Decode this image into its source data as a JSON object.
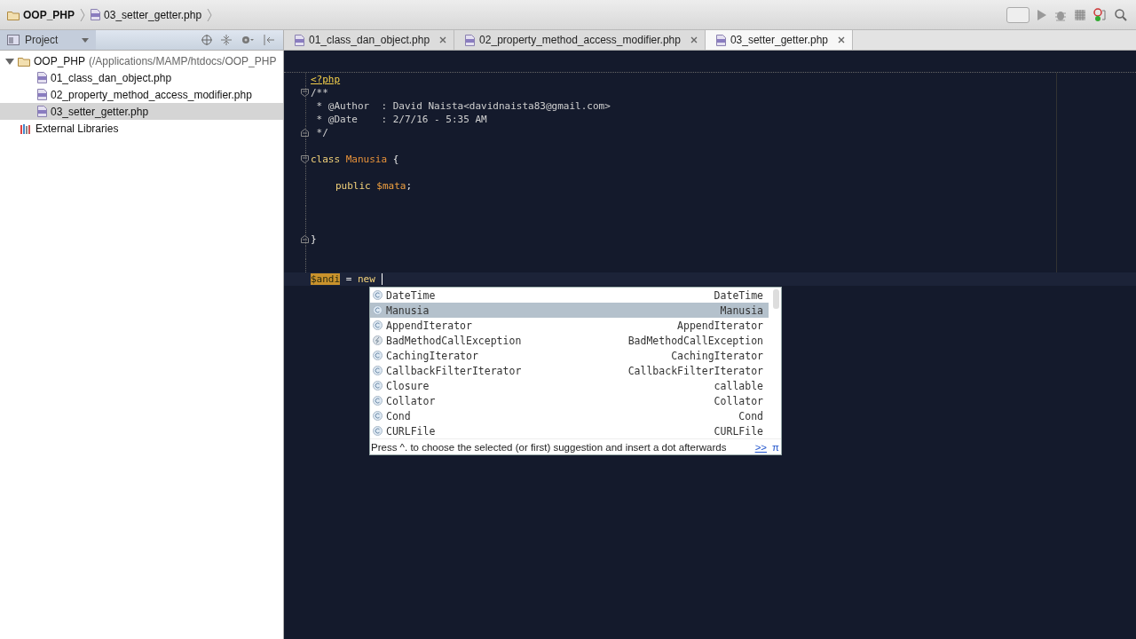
{
  "breadcrumb": [
    {
      "kind": "folder",
      "label": "OOP_PHP"
    },
    {
      "kind": "php",
      "label": "03_setter_getter.php"
    }
  ],
  "project_panel": {
    "title": "Project"
  },
  "tabs": [
    {
      "label": "01_class_dan_object.php",
      "selected": false
    },
    {
      "label": "02_property_method_access_modifier.php",
      "selected": false
    },
    {
      "label": "03_setter_getter.php",
      "selected": true
    }
  ],
  "tree": [
    {
      "kind": "folder",
      "label": "OOP_PHP",
      "path": " (/Applications/MAMP/htdocs/OOP_PHP",
      "expanded": true,
      "selected": false,
      "children": [
        {
          "kind": "php",
          "label": "01_class_dan_object.php",
          "selected": false
        },
        {
          "kind": "php",
          "label": "02_property_method_access_modifier.php",
          "selected": false
        },
        {
          "kind": "php",
          "label": "03_setter_getter.php",
          "selected": true
        }
      ]
    },
    {
      "kind": "library",
      "label": "External Libraries",
      "selected": false
    }
  ],
  "code_lines": [
    {
      "tokens": [
        {
          "kind": "tag",
          "text": "<?php"
        }
      ]
    },
    {
      "fold_start": true,
      "tokens": [
        {
          "kind": "comment",
          "text": "/**"
        }
      ]
    },
    {
      "tokens": [
        {
          "kind": "comment",
          "text": " * @Author  : David Naista<davidnaista83@gmail.com>"
        }
      ]
    },
    {
      "tokens": [
        {
          "kind": "comment",
          "text": " * @Date    : 2/7/16 - 5:35 AM"
        }
      ]
    },
    {
      "fold_end": true,
      "tokens": [
        {
          "kind": "comment",
          "text": " */"
        }
      ]
    },
    {
      "blank": true
    },
    {
      "fold_start": true,
      "tokens": [
        {
          "kind": "keyword",
          "text": "class"
        },
        {
          "kind": "classname",
          "text": " Manusia"
        },
        {
          "kind": "plain",
          "text": " {"
        }
      ]
    },
    {
      "blank": true
    },
    {
      "indented": true,
      "tokens": [
        {
          "kind": "keyword",
          "text": "public"
        },
        {
          "kind": "variable",
          "text": " $mata"
        },
        {
          "kind": "plain",
          "text": ";"
        }
      ]
    },
    {
      "blank": true
    },
    {
      "blank": true
    },
    {
      "blank": true
    },
    {
      "fold_end": true,
      "tokens": [
        {
          "kind": "plain",
          "text": "}"
        }
      ]
    },
    {
      "blank": true
    },
    {
      "blank": true
    },
    {
      "current": true,
      "tokens": [
        {
          "kind": "highlight",
          "text": "$andi"
        },
        {
          "kind": "plain",
          "text": " = "
        },
        {
          "kind": "keyword",
          "text": "new"
        }
      ]
    }
  ],
  "completion": {
    "items": [
      {
        "kind": "class",
        "name": "DateTime",
        "type": "DateTime",
        "selected": false
      },
      {
        "kind": "class",
        "name": "Manusia",
        "type": "Manusia",
        "selected": true
      },
      {
        "kind": "class",
        "name": "AppendIterator",
        "type": "AppendIterator",
        "selected": false
      },
      {
        "kind": "exception",
        "name": "BadMethodCallException",
        "type": "BadMethodCallException",
        "selected": false
      },
      {
        "kind": "class",
        "name": "CachingIterator",
        "type": "CachingIterator",
        "selected": false
      },
      {
        "kind": "class",
        "name": "CallbackFilterIterator",
        "type": "CallbackFilterIterator",
        "selected": false
      },
      {
        "kind": "class",
        "name": "Closure",
        "type": "callable",
        "selected": false
      },
      {
        "kind": "class",
        "name": "Collator",
        "type": "Collator",
        "selected": false
      },
      {
        "kind": "class",
        "name": "Cond",
        "type": "Cond",
        "selected": false
      },
      {
        "kind": "class",
        "name": "CURLFile",
        "type": "CURLFile",
        "selected": false
      }
    ],
    "hint": "Press ^. to choose the selected (or first) suggestion and insert a dot afterwards",
    "more_link": ">>",
    "pi": "π"
  }
}
